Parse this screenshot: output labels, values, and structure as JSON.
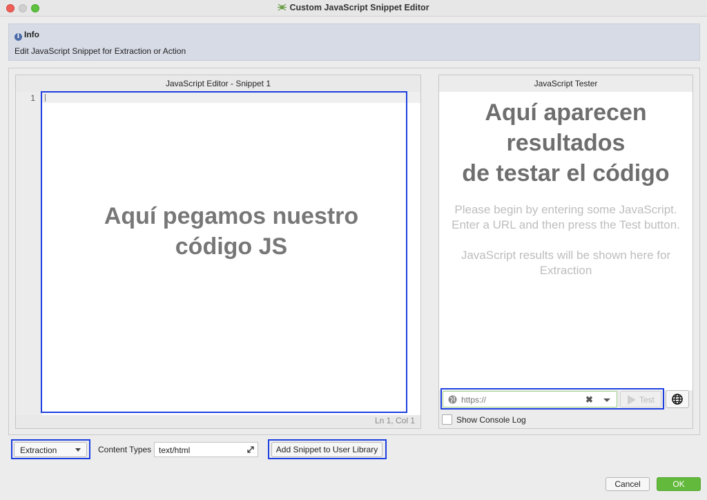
{
  "window": {
    "title": "Custom JavaScript Snippet Editor"
  },
  "info": {
    "heading": "Info",
    "text": "Edit JavaScript Snippet for Extraction or Action"
  },
  "editor": {
    "header": "JavaScript Editor - Snippet 1",
    "line_number": "1",
    "overlay_line1": "Aquí pegamos nuestro",
    "overlay_line2": "código JS",
    "status": "Ln 1, Col 1"
  },
  "tester": {
    "header": "JavaScript Tester",
    "overlay_line1": "Aquí aparecen",
    "overlay_line2": "resultados",
    "overlay_line3": "de testar el código",
    "placeholder_line1": "Please begin by entering some JavaScript.",
    "placeholder_line2": "Enter a URL and then press the Test button.",
    "result_text": "JavaScript results will be shown here for Extraction",
    "url_value": "https://",
    "test_label": "Test",
    "console_label": "Show Console Log",
    "console_checked": false
  },
  "bottom": {
    "mode_selected": "Extraction",
    "content_types_label": "Content Types",
    "content_types_value": "text/html",
    "add_button_label": "Add Snippet to User Library"
  },
  "dialog_buttons": {
    "cancel_label": "Cancel",
    "ok_label": "OK"
  },
  "colors": {
    "highlight": "#1d3fe0",
    "ok_button": "#63b93b",
    "info_bar": "#d7dbe6"
  }
}
